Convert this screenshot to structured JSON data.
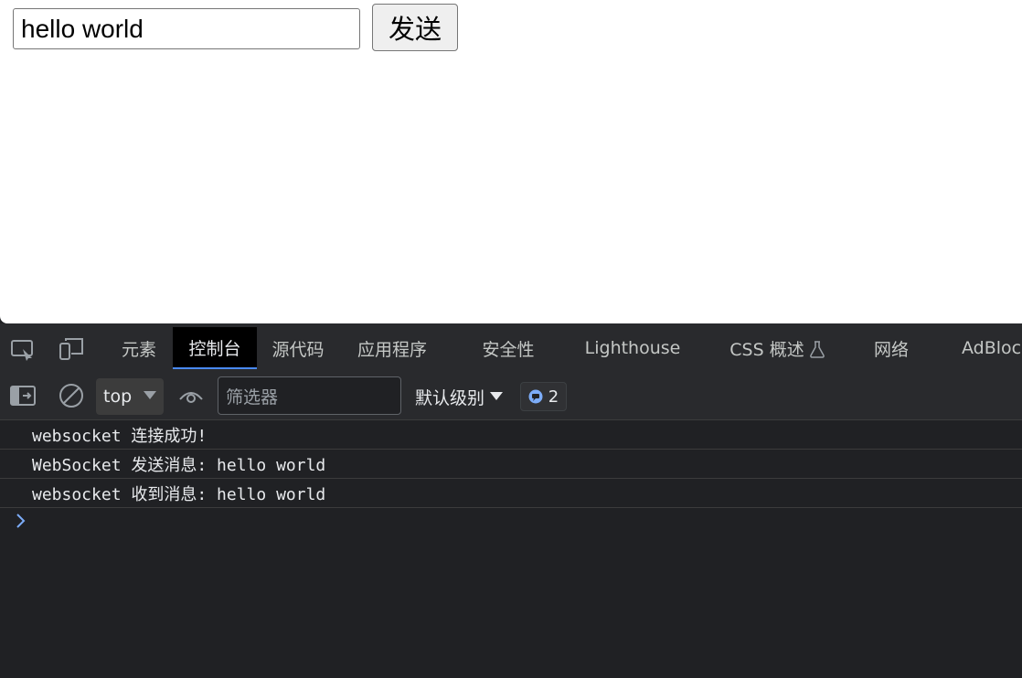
{
  "page": {
    "input_value": "hello world",
    "send_label": "发送"
  },
  "devtools": {
    "tabs": [
      "元素",
      "控制台",
      "源代码",
      "应用程序",
      "安全性",
      "Lighthouse",
      "CSS 概述",
      "网络",
      "AdBlock"
    ],
    "active_tab": "控制台",
    "context": "top",
    "filter_placeholder": "筛选器",
    "levels_label": "默认级别",
    "issues_count": "2",
    "log": [
      "websocket 连接成功!",
      "WebSocket 发送消息: hello world",
      "websocket 收到消息: hello world"
    ]
  },
  "colors": {
    "accent": "#4a8af4",
    "panel_bg": "#202124",
    "toolbar_bg": "#292a2d"
  }
}
